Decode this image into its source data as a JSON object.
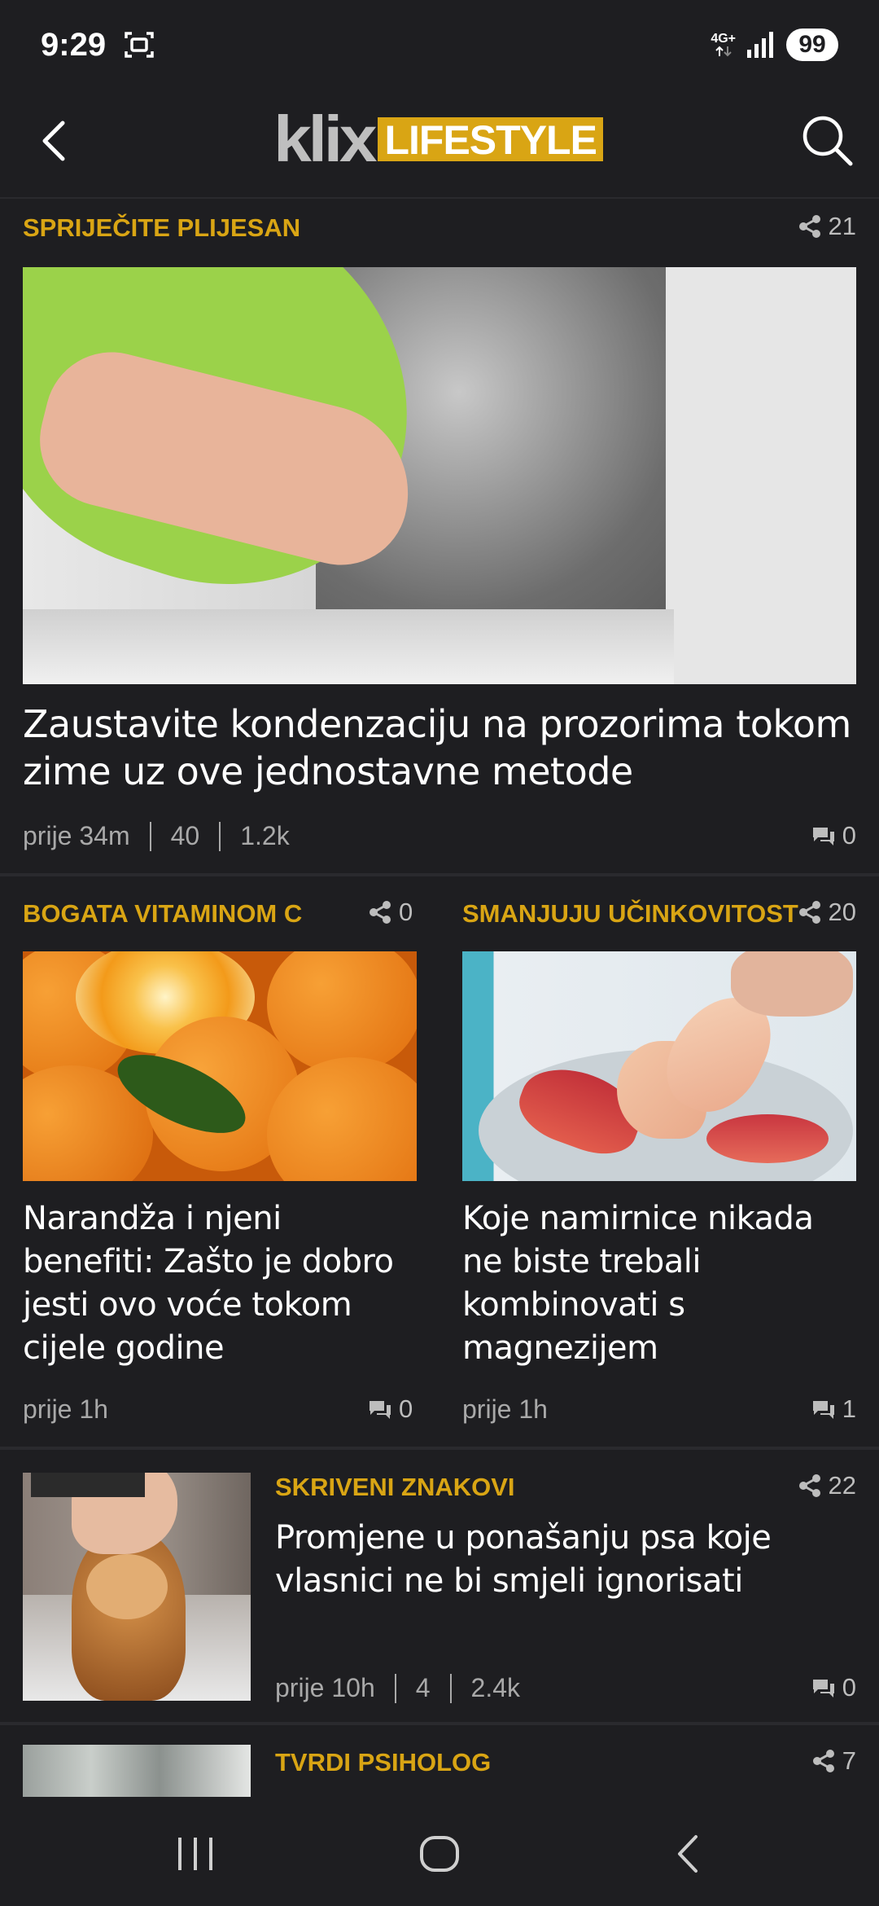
{
  "status_bar": {
    "time": "9:29",
    "network_top": "4G+",
    "battery": "99"
  },
  "header": {
    "logo_klix": "klix",
    "logo_section": "LIFESTYLE"
  },
  "articles": [
    {
      "kicker": "SPRIJEČITE PLIJESAN",
      "shares": "21",
      "title": "Zaustavite kondenzaciju na prozorima tokom zime uz ove jednostavne metode",
      "time": "prije 34m",
      "stat1": "40",
      "stat2": "1.2k",
      "comments": "0"
    },
    {
      "kicker": "BOGATA VITAMINOM C",
      "shares": "0",
      "title": "Narandža i njeni benefiti: Zašto je dobro jesti ovo voće tokom cijele godine",
      "time": "prije 1h",
      "comments": "0"
    },
    {
      "kicker": "SMANJUJU UČINKOVITOST",
      "shares": "20",
      "title": "Koje namirnice nikada ne biste trebali kombinovati s magnezijem",
      "time": "prije 1h",
      "comments": "1"
    },
    {
      "kicker": "SKRIVENI ZNAKOVI",
      "shares": "22",
      "title": "Promjene u ponašanju psa koje vlasnici ne bi smjeli ignorisati",
      "time": "prije 10h",
      "stat1": "4",
      "stat2": "2.4k",
      "comments": "0"
    },
    {
      "kicker": "TVRDI PSIHOLOG",
      "shares": "7"
    }
  ],
  "colors": {
    "accent": "#d9a514",
    "background": "#1e1e21",
    "text": "#ffffff",
    "muted": "#a9a9a9"
  }
}
